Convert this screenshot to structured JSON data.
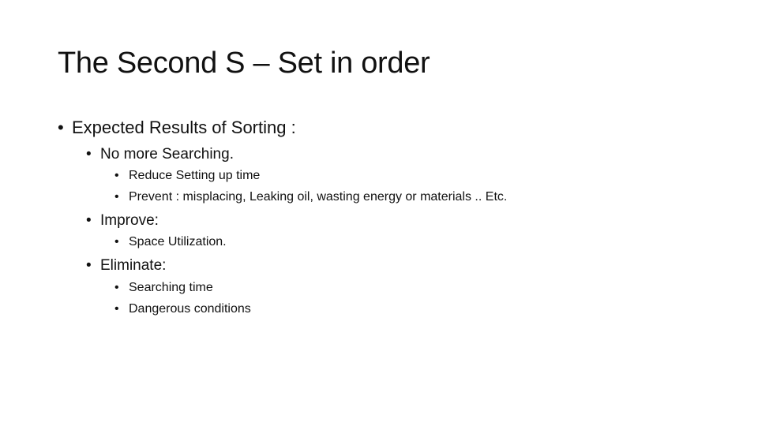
{
  "slide": {
    "title": "The Second S – Set in order",
    "bullet_glyph": "•",
    "items": [
      {
        "level": 1,
        "text": "Expected Results of Sorting :"
      },
      {
        "level": 2,
        "text": "No more Searching."
      },
      {
        "level": 3,
        "text": "Reduce Setting up time"
      },
      {
        "level": 3,
        "text": "Prevent : misplacing, Leaking oil, wasting energy or materials .. Etc."
      },
      {
        "level": 2,
        "text": "Improve:"
      },
      {
        "level": 3,
        "text": "Space Utilization."
      },
      {
        "level": 2,
        "text": "Eliminate:"
      },
      {
        "level": 3,
        "text": "Searching time"
      },
      {
        "level": 3,
        "text": "Dangerous conditions"
      }
    ]
  }
}
